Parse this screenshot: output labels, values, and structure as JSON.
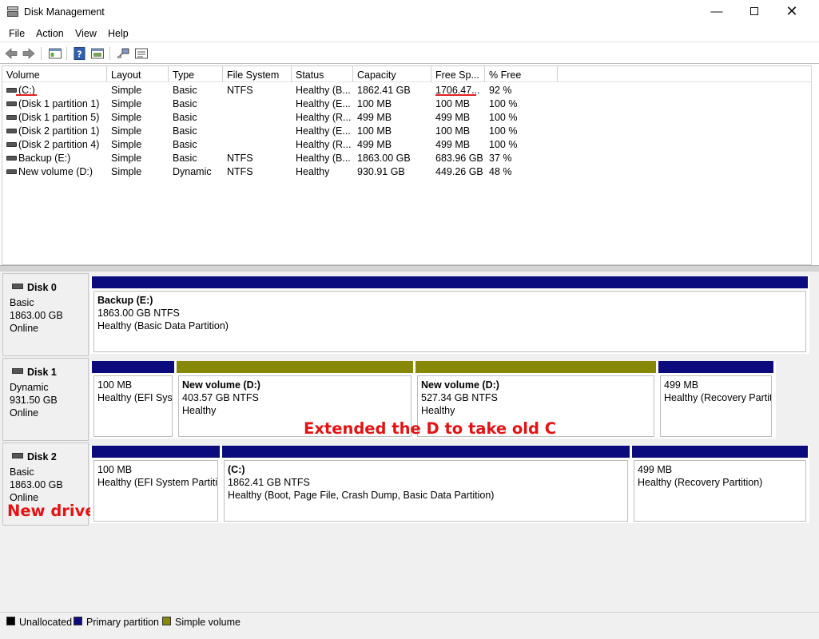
{
  "window": {
    "title": "Disk Management"
  },
  "menu": [
    "File",
    "Action",
    "View",
    "Help"
  ],
  "volume_list": {
    "columns": [
      "Volume",
      "Layout",
      "Type",
      "File System",
      "Status",
      "Capacity",
      "Free Sp...",
      "% Free"
    ],
    "rows": [
      [
        "(C:)",
        "Simple",
        "Basic",
        "NTFS",
        "Healthy (B...",
        "1862.41 GB",
        "1706.47...",
        "92 %"
      ],
      [
        "(Disk 1 partition 1)",
        "Simple",
        "Basic",
        "",
        "Healthy (E...",
        "100 MB",
        "100 MB",
        "100 %"
      ],
      [
        "(Disk 1 partition 5)",
        "Simple",
        "Basic",
        "",
        "Healthy (R...",
        "499 MB",
        "499 MB",
        "100 %"
      ],
      [
        "(Disk 2 partition 1)",
        "Simple",
        "Basic",
        "",
        "Healthy (E...",
        "100 MB",
        "100 MB",
        "100 %"
      ],
      [
        "(Disk 2 partition 4)",
        "Simple",
        "Basic",
        "",
        "Healthy (R...",
        "499 MB",
        "499 MB",
        "100 %"
      ],
      [
        "Backup (E:)",
        "Simple",
        "Basic",
        "NTFS",
        "Healthy (B...",
        "1863.00 GB",
        "683.96 GB",
        "37 %"
      ],
      [
        "New volume (D:)",
        "Simple",
        "Dynamic",
        "NTFS",
        "Healthy",
        "930.91 GB",
        "449.26 GB",
        "48 %"
      ]
    ]
  },
  "disks": [
    {
      "name": "Disk 0",
      "type": "Basic",
      "size": "1863.00 GB",
      "state": "Online",
      "partitions": [
        {
          "name": "Backup  (E:)",
          "line1": "1863.00 GB NTFS",
          "line2": "Healthy (Basic Data Partition)",
          "kind": "primary"
        }
      ]
    },
    {
      "name": "Disk 1",
      "type": "Dynamic",
      "size": "931.50 GB",
      "state": "Online",
      "partitions": [
        {
          "name": "",
          "line1": "100 MB",
          "line2": "Healthy (EFI Syst",
          "kind": "primary"
        },
        {
          "name": "New volume  (D:)",
          "line1": "403.57 GB NTFS",
          "line2": "Healthy",
          "kind": "simple"
        },
        {
          "name": "New volume  (D:)",
          "line1": "527.34 GB NTFS",
          "line2": "Healthy",
          "kind": "simple"
        },
        {
          "name": "",
          "line1": "499 MB",
          "line2": "Healthy (Recovery Partiti",
          "kind": "primary"
        }
      ]
    },
    {
      "name": "Disk 2",
      "type": "Basic",
      "size": "1863.00 GB",
      "state": "Online",
      "partitions": [
        {
          "name": "",
          "line1": "100 MB",
          "line2": "Healthy (EFI System Partitio",
          "kind": "primary"
        },
        {
          "name": "(C:)",
          "line1": "1862.41 GB NTFS",
          "line2": "Healthy (Boot, Page File, Crash Dump, Basic Data Partition)",
          "kind": "primary"
        },
        {
          "name": "",
          "line1": "499 MB",
          "line2": "Healthy (Recovery Partition)",
          "kind": "primary"
        }
      ]
    }
  ],
  "annotations": {
    "extended": "Extended the D to take old C",
    "new_drive": "New drive"
  },
  "legend": [
    "Unallocated",
    "Primary partition",
    "Simple volume"
  ],
  "colors": {
    "unallocated": "#000000",
    "primary": "#0b0b7d",
    "simple": "#878708",
    "annotation": "#e41212"
  }
}
